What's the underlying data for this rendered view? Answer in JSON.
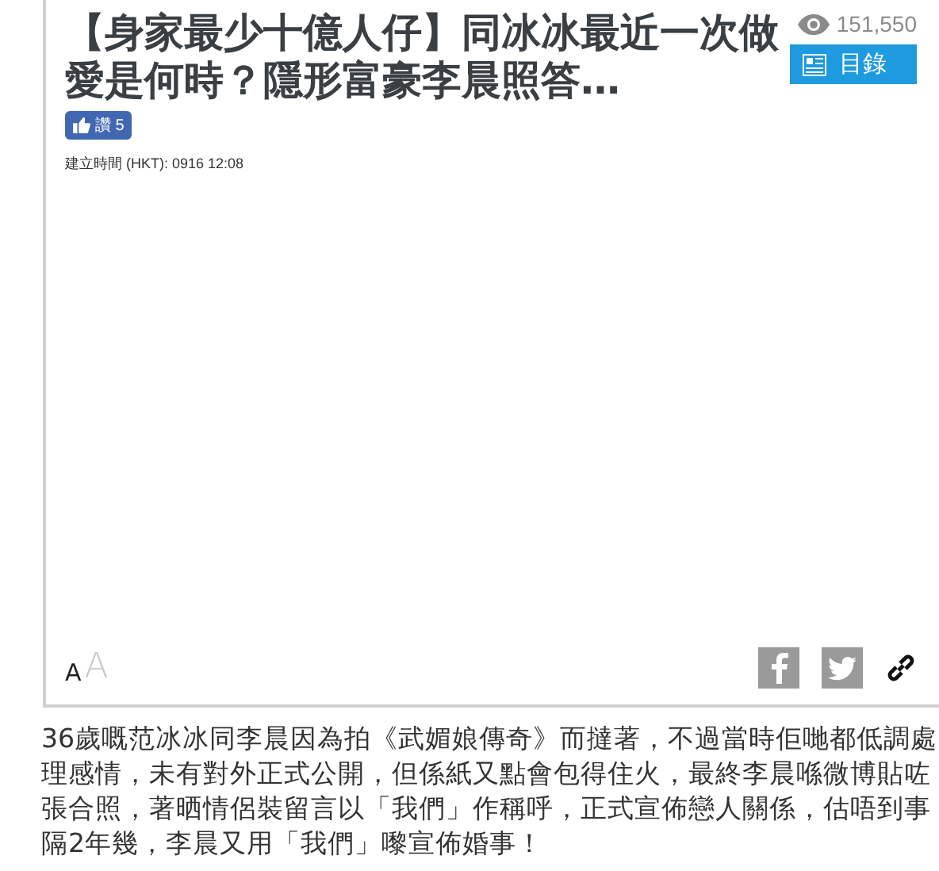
{
  "article": {
    "title": "【身家最少十億人仔】同冰冰最近一次做愛是何時？隱形富豪李晨照答…",
    "views": "151,550",
    "contents_button": "目錄",
    "like_button": "讚 5",
    "created_time": "建立時間 (HKT): 0916 12:08",
    "font_size_buttons": [
      "A",
      "A"
    ]
  },
  "body": "36歲嘅范冰冰同李晨因為拍《武媚娘傳奇》而撻著，不過當時佢哋都低調處理感情，未有對外正式公開，但係紙又點會包得住火，最終李晨喺微博貼咗張合照，著晒情侶裝留言以「我們」作稱呼，正式宣佈戀人關係，估唔到事隔2年幾，李晨又用「我們」嚟宣佈婚事！"
}
